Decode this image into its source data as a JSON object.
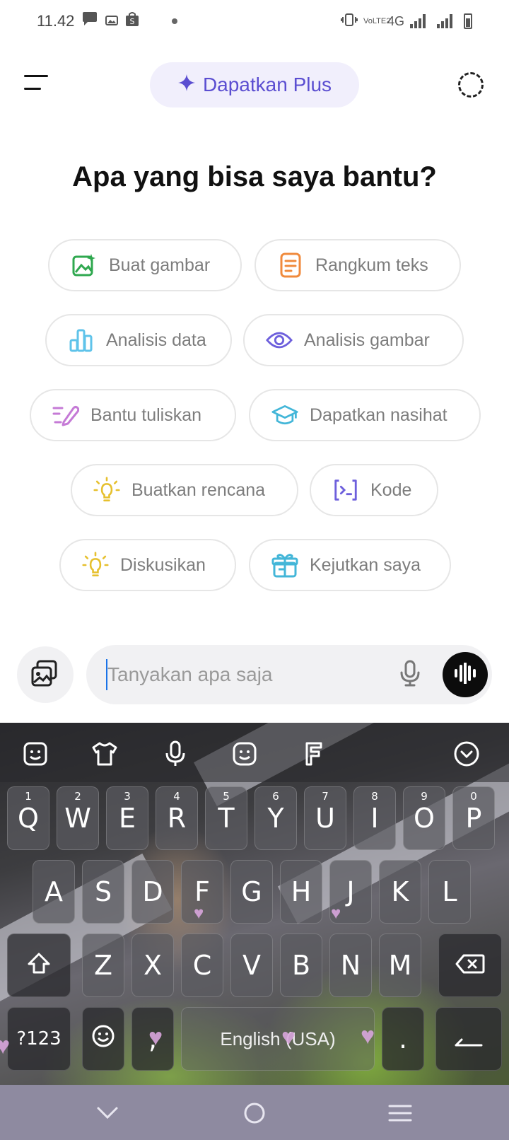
{
  "status_bar": {
    "time": "11.42",
    "network": "4G",
    "volte": "VoLTE2"
  },
  "header": {
    "plus_label": "Dapatkan Plus"
  },
  "main": {
    "headline": "Apa yang bisa saya bantu?",
    "chips": [
      {
        "label": "Buat gambar",
        "icon": "image-sparkle-icon",
        "color": "#2fa84f"
      },
      {
        "label": "Rangkum teks",
        "icon": "document-icon",
        "color": "#f08a3c"
      },
      {
        "label": "Analisis data",
        "icon": "bar-chart-icon",
        "color": "#5fc3ea"
      },
      {
        "label": "Analisis gambar",
        "icon": "eye-icon",
        "color": "#6d5fdc"
      },
      {
        "label": "Bantu tuliskan",
        "icon": "pen-icon",
        "color": "#c57ad6"
      },
      {
        "label": "Dapatkan nasihat",
        "icon": "graduation-cap-icon",
        "color": "#43b6d8"
      },
      {
        "label": "Buatkan rencana",
        "icon": "lightbulb-icon",
        "color": "#e6c02e"
      },
      {
        "label": "Kode",
        "icon": "code-icon",
        "color": "#6d5fdc"
      },
      {
        "label": "Diskusikan",
        "icon": "lightbulb-icon",
        "color": "#e6c02e"
      },
      {
        "label": "Kejutkan saya",
        "icon": "gift-icon",
        "color": "#43b6d8"
      }
    ]
  },
  "composer": {
    "placeholder": "Tanyakan apa saja"
  },
  "keyboard": {
    "row1": [
      {
        "key": "Q",
        "hint": "1"
      },
      {
        "key": "W",
        "hint": "2"
      },
      {
        "key": "E",
        "hint": "3"
      },
      {
        "key": "R",
        "hint": "4"
      },
      {
        "key": "T",
        "hint": "5"
      },
      {
        "key": "Y",
        "hint": "6"
      },
      {
        "key": "U",
        "hint": "7"
      },
      {
        "key": "I",
        "hint": "8"
      },
      {
        "key": "O",
        "hint": "9"
      },
      {
        "key": "P",
        "hint": "0"
      }
    ],
    "row2": [
      "A",
      "S",
      "D",
      "F",
      "G",
      "H",
      "J",
      "K",
      "L"
    ],
    "row3": [
      "Z",
      "X",
      "C",
      "V",
      "B",
      "N",
      "M"
    ],
    "symbols_label": "?123",
    "space_label": "English (USA)",
    "comma": ",",
    "period": "."
  }
}
